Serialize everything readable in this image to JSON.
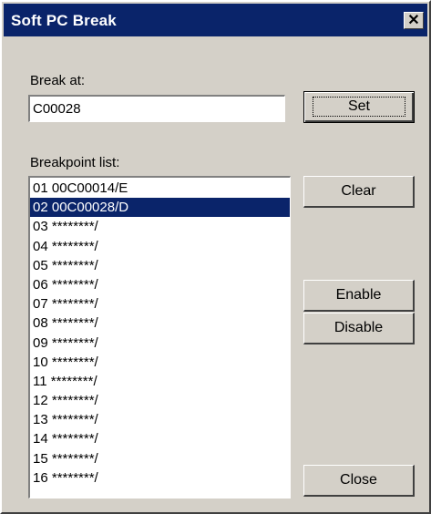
{
  "window": {
    "title": "Soft PC Break",
    "close_glyph": "✕"
  },
  "break_at": {
    "label": "Break at:",
    "value": "C00028"
  },
  "buttons": {
    "set": "Set",
    "clear": "Clear",
    "enable": "Enable",
    "disable": "Disable",
    "close": "Close"
  },
  "breakpoints": {
    "label": "Breakpoint list:",
    "selected_index": 1,
    "items": [
      "01 00C00014/E",
      "02 00C00028/D",
      "03 ********/",
      "04 ********/",
      "05 ********/",
      "06 ********/",
      "07 ********/",
      "08 ********/",
      "09 ********/",
      "10 ********/",
      "11 ********/",
      "12 ********/",
      "13 ********/",
      "14 ********/",
      "15 ********/",
      "16 ********/"
    ]
  }
}
